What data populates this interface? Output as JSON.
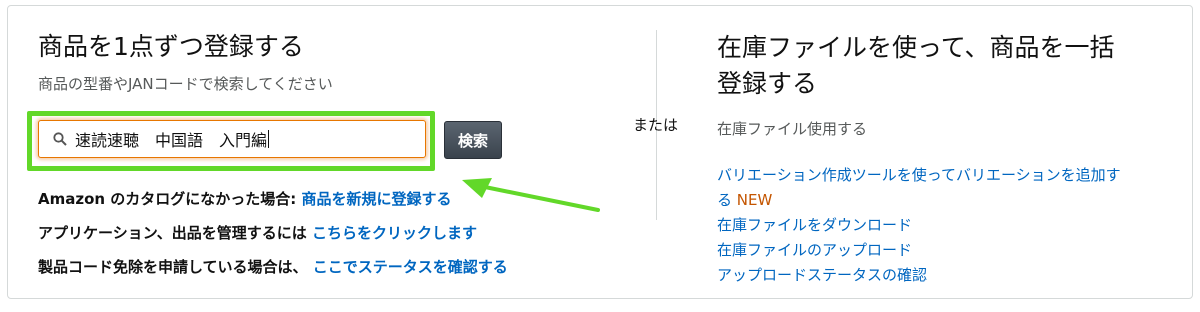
{
  "left_panel": {
    "title": "商品を1点ずつ登録する",
    "hint": "商品の型番やJANコードで検索してください",
    "search": {
      "value": "速読速聴　中国語　入門編",
      "button_label": "検索"
    },
    "lines": [
      {
        "text": "Amazon のカタログになかった場合: ",
        "link": "商品を新規に登録する"
      },
      {
        "text": "アプリケーション、出品を管理するには ",
        "link": "こちらをクリックします"
      },
      {
        "text": "製品コード免除を申請している場合は、 ",
        "link": "ここでステータスを確認する"
      }
    ]
  },
  "separator": {
    "or_label": "または"
  },
  "right_panel": {
    "title_line1": "在庫ファイルを使って、商品を一括",
    "title_line2": "登録する",
    "subtitle": "在庫ファイル使用する",
    "variation_link_line1": "バリエーション作成ツールを使ってバリエーションを追加す",
    "variation_link_line2": "る",
    "new_badge": "NEW",
    "download_link": "在庫ファイルをダウンロード",
    "upload_link": "在庫ファイルのアップロード",
    "status_link": "アップロードステータスの確認"
  },
  "colors": {
    "highlight_frame": "#62d829",
    "link": "#0066c0",
    "new_badge": "#c45500",
    "search_button": "#4a535c",
    "focus_border": "#e77600"
  },
  "icons": {
    "search": "search-icon",
    "annotation_arrow": "arrow-icon"
  }
}
